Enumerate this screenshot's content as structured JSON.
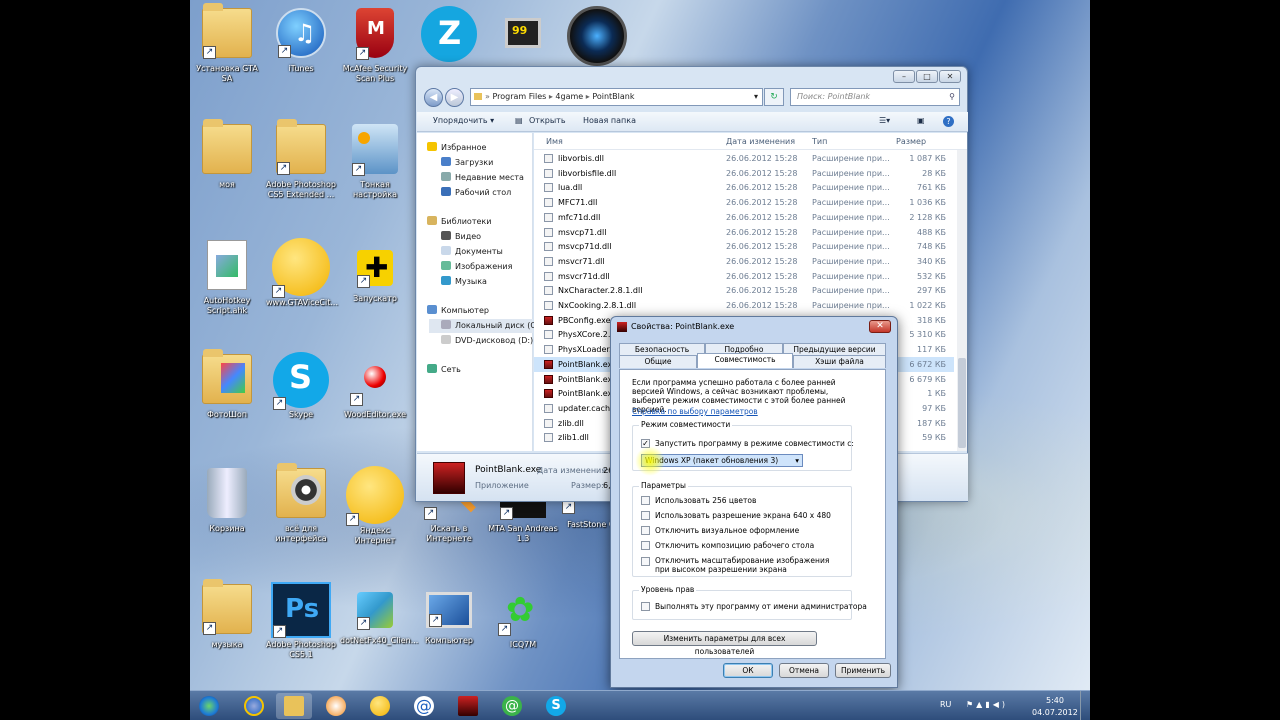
{
  "desktop": {
    "icons": [
      {
        "label": "Установка GTA SA",
        "icon": "folder-icon"
      },
      {
        "label": "iTunes",
        "icon": "itunes-icon"
      },
      {
        "label": "McAfee Security Scan Plus",
        "icon": "mcafee-icon"
      },
      {
        "label": "Z",
        "icon": "zona-icon"
      },
      {
        "label": "99",
        "icon": "display-icon"
      },
      {
        "label": "",
        "icon": "camera-lens-icon"
      },
      {
        "label": "моя",
        "icon": "folder-icon"
      },
      {
        "label": "Adobe Photoshop CS5 Extended ...",
        "icon": "folder-icon"
      },
      {
        "label": "Тонкая настройка",
        "icon": "tuning-icon"
      },
      {
        "label": "AutoHotkey Script.ahk",
        "icon": "document-icon"
      },
      {
        "label": "www.GTAViceCit...",
        "icon": "globe-icon"
      },
      {
        "label": "Запускатр",
        "icon": "plus-tile-icon"
      },
      {
        "label": "ФотоШоп",
        "icon": "photo-folder-icon"
      },
      {
        "label": "Skype",
        "icon": "skype-icon"
      },
      {
        "label": "WoodEditor.exe",
        "icon": "molecule-icon"
      },
      {
        "label": "Корзина",
        "icon": "recycle-bin-icon"
      },
      {
        "label": "всё для интерфейса",
        "icon": "folder-icon"
      },
      {
        "label": "Яндекс Интернет",
        "icon": "globe-icon"
      },
      {
        "label": "Искать в Интернете",
        "icon": "search-icon"
      },
      {
        "label": "MTA San Andreas 1.3",
        "icon": "mta-icon"
      },
      {
        "label": "FastStone Ca...",
        "icon": "faststone-icon"
      },
      {
        "label": "музыка",
        "icon": "folder-icon"
      },
      {
        "label": "Adobe Photoshop CS5.1",
        "icon": "photoshop-icon"
      },
      {
        "label": "dotNetFx40_Clien...",
        "icon": "installer-icon"
      },
      {
        "label": "Компьютер",
        "icon": "computer-icon"
      },
      {
        "label": "ICQ7M",
        "icon": "icq-icon"
      }
    ]
  },
  "explorer": {
    "breadcrumb": [
      "Program Files",
      "4game",
      "PointBlank"
    ],
    "search_placeholder": "Поиск: PointBlank",
    "toolbar": {
      "organize": "Упорядочить ▾",
      "open": "Открыть",
      "new_folder": "Новая папка"
    },
    "nav": {
      "favorites": "Избранное",
      "fav_items": [
        "Загрузки",
        "Недавние места",
        "Рабочий стол"
      ],
      "libraries": "Библиотеки",
      "lib_items": [
        "Видео",
        "Документы",
        "Изображения",
        "Музыка"
      ],
      "computer": "Компьютер",
      "comp_items": [
        "Локальный диск (C:)",
        "DVD-дисковод (D:) I"
      ],
      "network": "Сеть"
    },
    "columns": {
      "name": "Имя",
      "date": "Дата изменения",
      "type": "Тип",
      "size": "Размер"
    },
    "files": [
      {
        "name": "libvorbis.dll",
        "date": "26.06.2012 15:28",
        "type": "Расширение при...",
        "size": "1 087 КБ"
      },
      {
        "name": "libvorbisfile.dll",
        "date": "26.06.2012 15:28",
        "type": "Расширение при...",
        "size": "28 КБ"
      },
      {
        "name": "lua.dll",
        "date": "26.06.2012 15:28",
        "type": "Расширение при...",
        "size": "761 КБ"
      },
      {
        "name": "MFC71.dll",
        "date": "26.06.2012 15:28",
        "type": "Расширение при...",
        "size": "1 036 КБ"
      },
      {
        "name": "mfc71d.dll",
        "date": "26.06.2012 15:28",
        "type": "Расширение при...",
        "size": "2 128 КБ"
      },
      {
        "name": "msvcp71.dll",
        "date": "26.06.2012 15:28",
        "type": "Расширение при...",
        "size": "488 КБ"
      },
      {
        "name": "msvcp71d.dll",
        "date": "26.06.2012 15:28",
        "type": "Расширение при...",
        "size": "748 КБ"
      },
      {
        "name": "msvcr71.dll",
        "date": "26.06.2012 15:28",
        "type": "Расширение при...",
        "size": "340 КБ"
      },
      {
        "name": "msvcr71d.dll",
        "date": "26.06.2012 15:28",
        "type": "Расширение при...",
        "size": "532 КБ"
      },
      {
        "name": "NxCharacter.2.8.1.dll",
        "date": "26.06.2012 15:28",
        "type": "Расширение при...",
        "size": "297 КБ"
      },
      {
        "name": "NxCooking.2.8.1.dll",
        "date": "26.06.2012 15:28",
        "type": "Расширение при...",
        "size": "1 022 КБ"
      },
      {
        "name": "PBConfig.exe",
        "date": "",
        "type": "",
        "size": "318 КБ"
      },
      {
        "name": "PhysXCore.2.8...",
        "date": "",
        "type": "",
        "size": "5 310 КБ"
      },
      {
        "name": "PhysXLoader...",
        "date": "",
        "type": "",
        "size": "117 КБ"
      },
      {
        "name": "PointBlank.exe",
        "date": "",
        "type": "",
        "size": "6 672 КБ"
      },
      {
        "name": "PointBlank.exe",
        "date": "",
        "type": "",
        "size": "6 679 КБ"
      },
      {
        "name": "PointBlank.exe",
        "date": "",
        "type": "",
        "size": "1 КБ"
      },
      {
        "name": "updater.cache",
        "date": "",
        "type": "",
        "size": "97 КБ"
      },
      {
        "name": "zlib.dll",
        "date": "",
        "type": "",
        "size": "187 КБ"
      },
      {
        "name": "zlib1.dll",
        "date": "",
        "type": "",
        "size": "59 КБ"
      }
    ],
    "details": {
      "name": "PointBlank.exe",
      "date_label": "Дата изменения:",
      "date_value": "26.",
      "kind": "Приложение",
      "size_label": "Размер:",
      "size_value": "6,"
    }
  },
  "dialog": {
    "title": "Свойства: PointBlank.exe",
    "tabs_top": [
      "Безопасность",
      "Подробно",
      "Предыдущие версии"
    ],
    "tabs_bottom": [
      "Общие",
      "Совместимость",
      "Хэши файла"
    ],
    "intro": "Если программа успешно работала с более ранней версией Windows, а сейчас возникают проблемы, выберите режим совместимости с этой более ранней версией.",
    "help_link": "Справка по выбору параметров",
    "compat_group": "Режим совместимости",
    "compat_checkbox": "Запустить программу в режиме совместимости с:",
    "compat_select": "Windows XP (пакет обновления 3)",
    "params_group": "Параметры",
    "params": [
      "Использовать 256 цветов",
      "Использовать разрешение экрана 640 x 480",
      "Отключить визуальное оформление",
      "Отключить композицию рабочего стола",
      "Отключить масштабирование изображения при высоком разрешении экрана"
    ],
    "rights_group": "Уровень прав",
    "rights_checkbox": "Выполнять эту программу от имени администратора",
    "all_users_button": "Изменить параметры для всех пользователей",
    "ok": "ОК",
    "cancel": "Отмена",
    "apply": "Применить"
  },
  "taskbar": {
    "lang": "RU",
    "time": "5:40",
    "date": "04.07.2012"
  }
}
